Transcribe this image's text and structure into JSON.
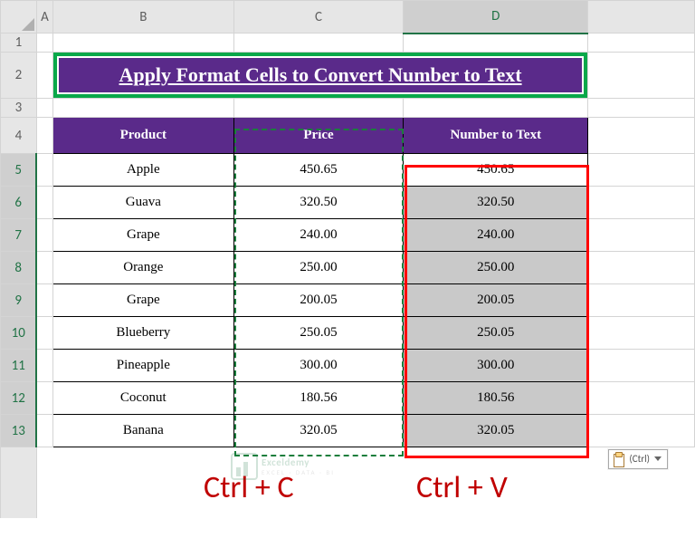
{
  "columns": {
    "A": "A",
    "B": "B",
    "C": "C",
    "D": "D"
  },
  "rows": [
    "1",
    "2",
    "3",
    "4",
    "5",
    "6",
    "7",
    "8",
    "9",
    "10",
    "11",
    "12",
    "13"
  ],
  "title": "Apply Format Cells to Convert Number to Text",
  "headers": {
    "product": "Product",
    "price": "Price",
    "n2t": "Number to Text"
  },
  "data": [
    {
      "product": "Apple",
      "price": "450.65",
      "n2t": "450.65"
    },
    {
      "product": "Guava",
      "price": "320.50",
      "n2t": "320.50"
    },
    {
      "product": "Grape",
      "price": "240.00",
      "n2t": "240.00"
    },
    {
      "product": "Orange",
      "price": "250.00",
      "n2t": "250.00"
    },
    {
      "product": "Grape",
      "price": "200.05",
      "n2t": "200.05"
    },
    {
      "product": "Blueberry",
      "price": "250.05",
      "n2t": "250.05"
    },
    {
      "product": "Pineapple",
      "price": "300.00",
      "n2t": "300.00"
    },
    {
      "product": "Coconut",
      "price": "180.56",
      "n2t": "180.56"
    },
    {
      "product": "Banana",
      "price": "320.05",
      "n2t": "320.05"
    }
  ],
  "labels": {
    "copy": "Ctrl + C",
    "paste": "Ctrl + V",
    "pasteBtn": "(Ctrl)"
  },
  "watermark": {
    "brand": "Exceldemy",
    "tag": "EXCEL · DATA · BI"
  }
}
